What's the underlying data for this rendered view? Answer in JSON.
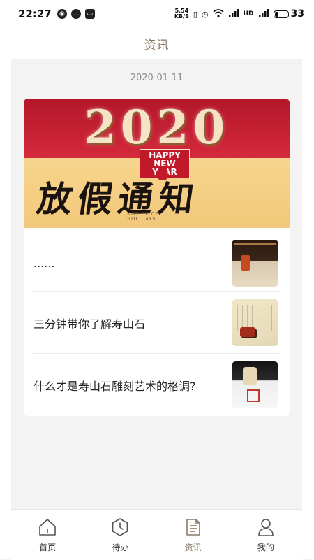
{
  "status_bar": {
    "time": "22:27",
    "net_speed_value": "5.54",
    "net_speed_unit": "KB/S",
    "battery": "33",
    "battery_level": 0.33
  },
  "header": {
    "title": "资讯"
  },
  "content": {
    "date": "2020-01-11",
    "banner": {
      "year_text": "2020",
      "happy_new_year": "HAPPY NEW YEAR",
      "calligraphy": "放假通知",
      "notice_text": "NOTICE OF HOLIDAYS"
    },
    "news": [
      {
        "title": "......"
      },
      {
        "title": "三分钟带你了解寿山石"
      },
      {
        "title": "什么才是寿山石雕刻艺术的格调?"
      }
    ]
  },
  "tabs": [
    {
      "label": "首页",
      "icon": "home-icon",
      "active": false
    },
    {
      "label": "待办",
      "icon": "clock-icon",
      "active": false
    },
    {
      "label": "资讯",
      "icon": "document-icon",
      "active": true
    },
    {
      "label": "我的",
      "icon": "user-icon",
      "active": false
    }
  ],
  "colors": {
    "accent": "#8a7a66",
    "background": "#f3f3f3"
  }
}
